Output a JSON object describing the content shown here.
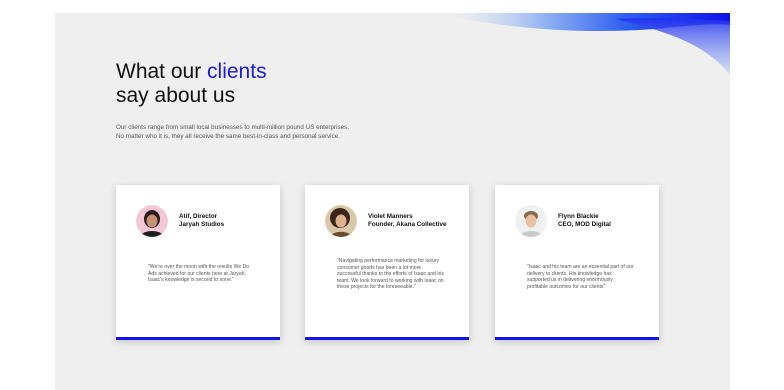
{
  "header": {
    "title_line1_prefix": "What our ",
    "title_line1_accent": "clients",
    "title_line2": "say about us",
    "description_line1": "Our clients range from small local businesses to multi-million pound US enterprises.",
    "description_line2": "No matter who it is, they all receive the same best-in-class and personal service."
  },
  "testimonials": [
    {
      "name_line1": "Atif, Director",
      "name_line2": "Jaryah Studios",
      "quote": "\"We're over the moon with the results We Do Ads achieved for our clients here at Jaryah. Isaac's knowledge is second to none.\""
    },
    {
      "name_line1": "Violet Manners",
      "name_line2": "Founder, Akana Collective",
      "quote": "\"Navigating performance marketing for luxury consumer goods has been a lot more successful thanks to the efforts of Isaac and his team. We look forward to working with Isaac on these projects for the foreseeable.\""
    },
    {
      "name_line1": "Flynn Blackie",
      "name_line2": "CEO, MOD Digital",
      "quote": "\"Isaac and his team are an essential part of our delivery to clients. His knowledge has supported us in delivering enormously profitable outcomes for our clients\""
    }
  ],
  "colors": {
    "accent": "#1a1ae0",
    "card_bar": "#1414e6",
    "panel_background": "#efefef"
  }
}
